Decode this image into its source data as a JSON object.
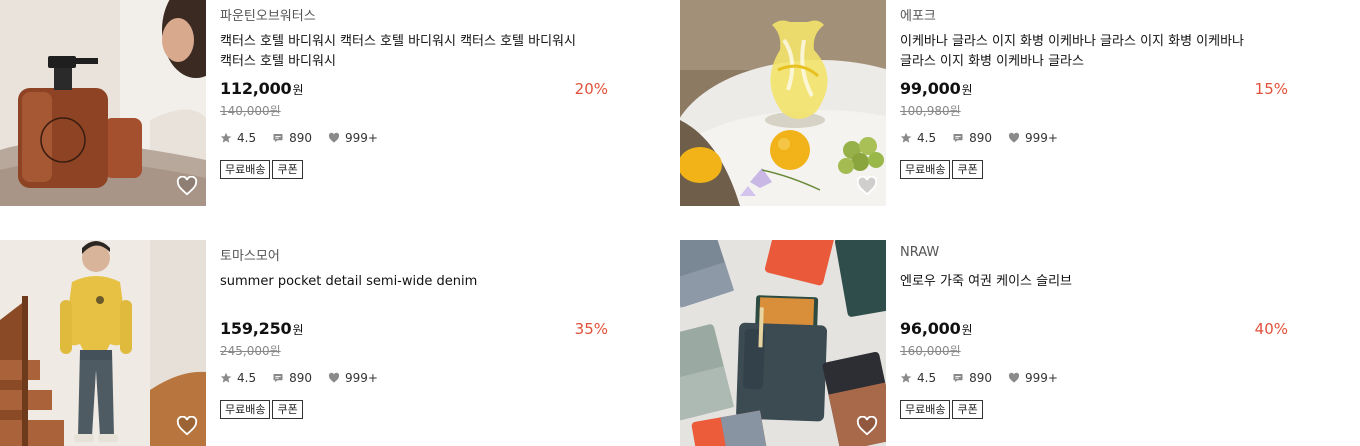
{
  "products": [
    {
      "brand": "파운틴오브워터스",
      "title": "캑터스 호텔 바디워시 캑터스 호텔 바디워시 캑터스 호텔 바디워시 캑터스 호텔 바디워시",
      "price": "112,000",
      "currency": "원",
      "original_price": "140,000원",
      "discount": "20%",
      "rating": "4.5",
      "reviews": "890",
      "likes": "999+",
      "tags": [
        "무료배송",
        "쿠폰"
      ]
    },
    {
      "brand": "에포크",
      "title": "이케바나 글라스 이지 화병 이케바나 글라스 이지 화병 이케바나 글라스 이지 화병 이케바나 글라스",
      "price": "99,000",
      "currency": "원",
      "original_price": "100,980원",
      "discount": "15%",
      "rating": "4.5",
      "reviews": "890",
      "likes": "999+",
      "tags": [
        "무료배송",
        "쿠폰"
      ]
    },
    {
      "brand": "토마스모어",
      "title": "summer pocket detail semi-wide denim",
      "price": "159,250",
      "currency": "원",
      "original_price": "245,000원",
      "discount": "35%",
      "rating": "4.5",
      "reviews": "890",
      "likes": "999+",
      "tags": [
        "무료배송",
        "쿠폰"
      ]
    },
    {
      "brand": "NRAW",
      "title": "엔로우 가죽 여권 케이스 슬리브",
      "price": "96,000",
      "currency": "원",
      "original_price": "160,000원",
      "discount": "40%",
      "rating": "4.5",
      "reviews": "890",
      "likes": "999+",
      "tags": [
        "무료배송",
        "쿠폰"
      ]
    }
  ],
  "icons": {
    "rating": "star-icon",
    "reviews": "speech-bubble-icon",
    "likes": "heart-icon",
    "wishlist": "heart-outline-icon"
  },
  "colors": {
    "discount": "#e0503a",
    "stat_icon": "#8a8a8a",
    "tag_border": "#333333"
  }
}
